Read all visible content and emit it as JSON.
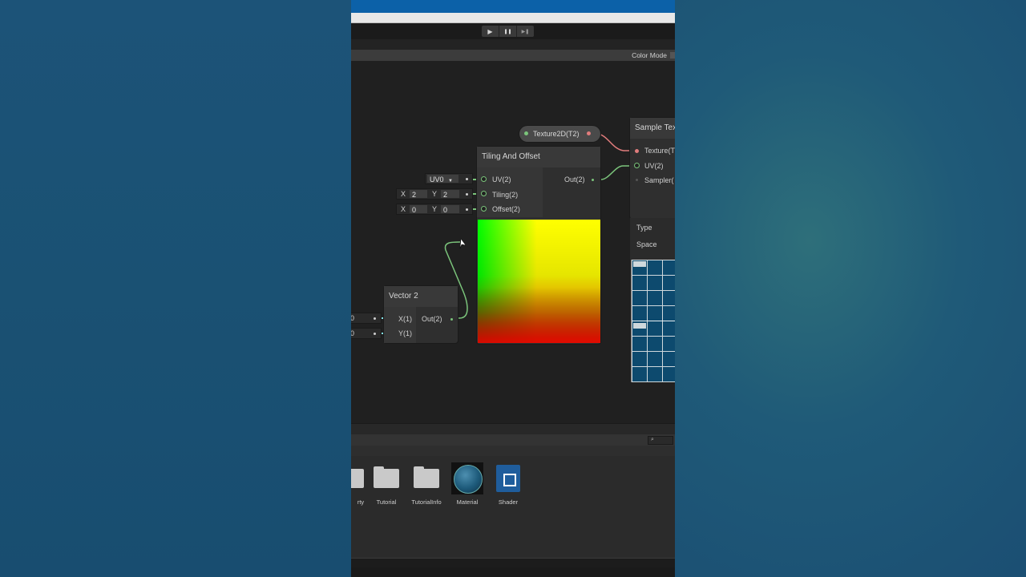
{
  "toolbar": {
    "play": "▶",
    "pause": "❚❚",
    "step": "▶❚"
  },
  "graph_header": {
    "color_mode_label": "Color Mode"
  },
  "nodes": {
    "texture_property": {
      "label": "Texture2D(T2)"
    },
    "tiling_offset": {
      "title": "Tiling And Offset",
      "inputs": [
        "UV(2)",
        "Tiling(2)",
        "Offset(2)"
      ],
      "output": "Out(2)",
      "uv_dropdown": "UV0",
      "tiling": {
        "x_label": "X",
        "x_value": "2",
        "y_label": "Y",
        "y_value": "2"
      },
      "offset": {
        "x_label": "X",
        "x_value": "0",
        "y_label": "Y",
        "y_value": "0"
      }
    },
    "vector2": {
      "title": "Vector 2",
      "inputs": [
        "X(1)",
        "Y(1)"
      ],
      "output": "Out(2)",
      "x_value": "0",
      "y_value": "0"
    },
    "sample_texture": {
      "title": "Sample Tex",
      "inputs": [
        "Texture(T",
        "UV(2)",
        "Sampler("
      ],
      "props": [
        "Type",
        "Space"
      ]
    }
  },
  "project": {
    "assets": [
      {
        "label": "rty",
        "icon": "folder-icon"
      },
      {
        "label": "Tutorial",
        "icon": "folder-icon"
      },
      {
        "label": "TutorialInfo",
        "icon": "folder-icon"
      },
      {
        "label": "Material",
        "icon": "material-sphere-icon"
      },
      {
        "label": "Shader",
        "icon": "shader-graph-icon"
      }
    ]
  },
  "colors": {
    "vector_wire": "#7bc47b",
    "texture_wire": "#e07c7c",
    "float_wire": "#84e4e7",
    "editor_bg": "#202020"
  }
}
